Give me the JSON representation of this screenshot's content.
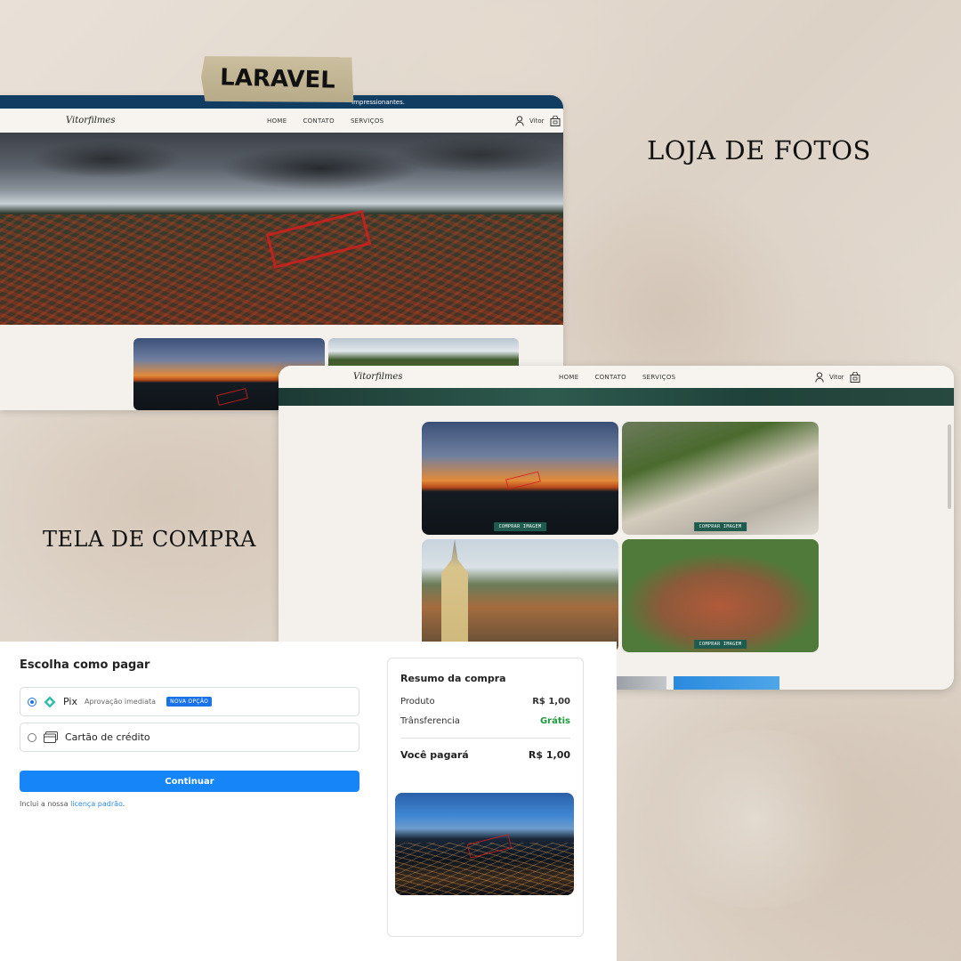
{
  "captions": {
    "tape": "LARAVEL",
    "store": "LOJA DE FOTOS",
    "checkout": "TELA DE COMPRA"
  },
  "store_window": {
    "topbar_text": "impressionantes.",
    "logo": "Vitorfilmes",
    "nav": [
      "HOME",
      "CONTATO",
      "SERVIÇOS"
    ],
    "user_name": "Vitor",
    "icons": [
      "user-icon",
      "cart-icon"
    ]
  },
  "gallery_window": {
    "logo": "Vitorfilmes",
    "nav": [
      "HOME",
      "CONTATO",
      "SERVIÇOS"
    ],
    "user_name": "Vitor",
    "buy_label": "COMPRAR IMAGEM"
  },
  "checkout": {
    "title": "Escolha como pagar",
    "options": [
      {
        "label": "Pix",
        "sub": "Aprovação imediata",
        "badge": "NOVA OPÇÃO",
        "selected": true,
        "icon": "pix-icon"
      },
      {
        "label": "Cartão de crédito",
        "selected": false,
        "icon": "credit-card-icon"
      }
    ],
    "continue_label": "Continuar",
    "fine_prefix": "Inclui a nossa ",
    "fine_link": "licença padrão",
    "fine_suffix": ".",
    "accent_color": "#1685f8"
  },
  "summary": {
    "title": "Resumo da compra",
    "product_label": "Produto",
    "product_value": "R$ 1,00",
    "transfer_label": "Trânsferencia",
    "transfer_value": "Grátis",
    "total_label": "Você pagará",
    "total_value": "R$ 1,00"
  }
}
